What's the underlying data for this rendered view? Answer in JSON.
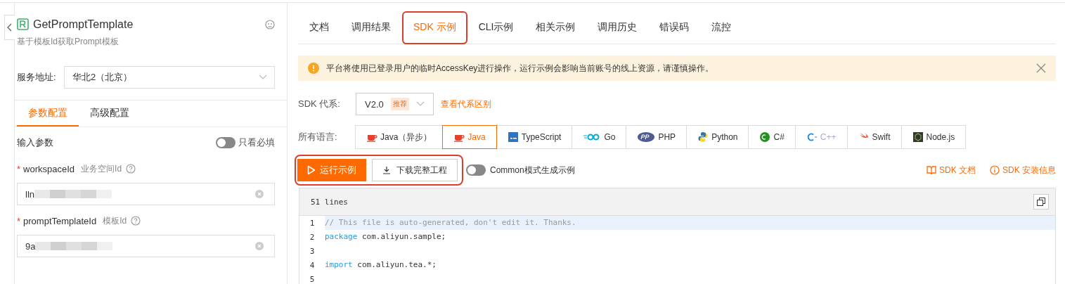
{
  "api": {
    "title": "GetPromptTemplate",
    "description": "基于模板Id获取Prompt模板"
  },
  "region": {
    "label": "服务地址:",
    "value": "华北2（北京）"
  },
  "config_tabs": [
    {
      "label": "参数配置",
      "selected": true
    },
    {
      "label": "高级配置",
      "selected": false
    }
  ],
  "input_params": {
    "title": "输入参数",
    "required_only": {
      "label": "只看必填",
      "on": false
    }
  },
  "params": [
    {
      "name": "workspaceId",
      "required_mark": "*",
      "description": "业务空间Id",
      "value": "lln",
      "redacted": true
    },
    {
      "name": "promptTemplateId",
      "required_mark": "*",
      "description": "模板Id",
      "value": "9a",
      "redacted": true
    }
  ],
  "tabs": [
    {
      "label": "文档",
      "selected": false,
      "highlighted": false
    },
    {
      "label": "调用结果",
      "selected": false,
      "highlighted": false
    },
    {
      "label": "SDK 示例",
      "selected": true,
      "highlighted": true
    },
    {
      "label": "CLI示例",
      "selected": false,
      "highlighted": false
    },
    {
      "label": "相关示例",
      "selected": false,
      "highlighted": false
    },
    {
      "label": "调用历史",
      "selected": false,
      "highlighted": false
    },
    {
      "label": "错误码",
      "selected": false,
      "highlighted": false
    },
    {
      "label": "流控",
      "selected": false,
      "highlighted": false
    }
  ],
  "notice": {
    "text": "平台将使用已登录用户的临时AccessKey进行操作，运行示例会影响当前账号的线上资源，请谨慎操作。"
  },
  "sdk_generation": {
    "label": "SDK 代系:",
    "value": "V2.0",
    "badge": "推荐",
    "link": "查看代系区别"
  },
  "languages": {
    "label": "所有语言:",
    "items": [
      {
        "label": "Java（异步）",
        "kind": "java",
        "selected": false,
        "disabled": false
      },
      {
        "label": "Java",
        "kind": "java",
        "selected": true,
        "disabled": false
      },
      {
        "label": "TypeScript",
        "kind": "ts",
        "selected": false,
        "disabled": false
      },
      {
        "label": "Go",
        "kind": "go",
        "selected": false,
        "disabled": false
      },
      {
        "label": "PHP",
        "kind": "php",
        "selected": false,
        "disabled": false
      },
      {
        "label": "Python",
        "kind": "python",
        "selected": false,
        "disabled": false
      },
      {
        "label": "C#",
        "kind": "csharp",
        "selected": false,
        "disabled": false
      },
      {
        "label": "C++",
        "kind": "cpp",
        "selected": false,
        "disabled": true
      },
      {
        "label": "Swift",
        "kind": "swift",
        "selected": false,
        "disabled": false
      },
      {
        "label": "Node.js",
        "kind": "node",
        "selected": false,
        "disabled": false
      }
    ]
  },
  "actions": {
    "highlighted": true,
    "run": "运行示例",
    "download": "下载完整工程",
    "common_mode": {
      "label": "Common模式生成示例",
      "on": false
    }
  },
  "links": [
    {
      "label": "SDK 文档",
      "kind": "book"
    },
    {
      "label": "SDK 安装信息",
      "kind": "info"
    }
  ],
  "code": {
    "line_count": "51 lines",
    "lines": [
      {
        "number": "1",
        "highlighted": true,
        "tokens": [
          {
            "kind": "comment",
            "text": "// This file is auto-generated, don't edit it. Thanks."
          }
        ]
      },
      {
        "number": "2",
        "highlighted": false,
        "tokens": [
          {
            "kind": "keyword",
            "text": "package"
          },
          {
            "kind": "plain",
            "text": " com.aliyun.sample;"
          }
        ]
      },
      {
        "number": "3",
        "highlighted": false
      },
      {
        "number": "4",
        "highlighted": false,
        "tokens": [
          {
            "kind": "keyword",
            "text": "import"
          },
          {
            "kind": "plain",
            "text": " com.aliyun.tea.*;"
          }
        ]
      },
      {
        "number": "5",
        "highlighted": false
      }
    ]
  }
}
